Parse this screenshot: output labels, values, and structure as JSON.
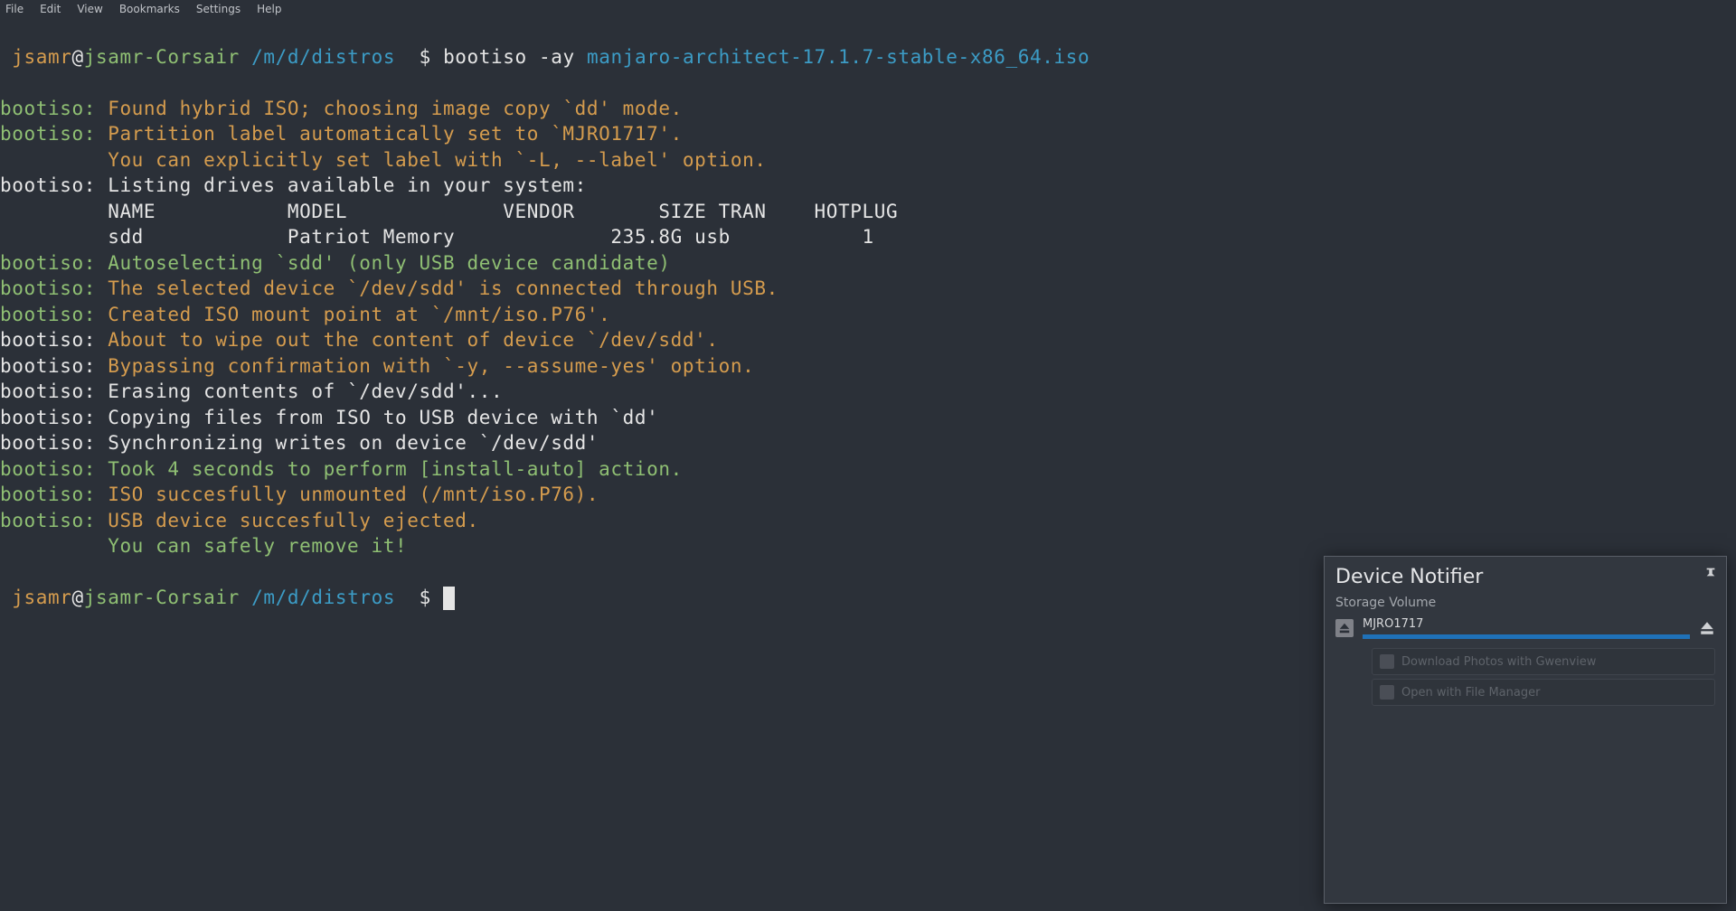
{
  "menubar": [
    "File",
    "Edit",
    "View",
    "Bookmarks",
    "Settings",
    "Help"
  ],
  "prompt": {
    "user": "jsamr",
    "at": "@",
    "host": "jsamr-Corsair",
    "path": "/m/d/distros",
    "symbol": "$"
  },
  "command": {
    "bin": "bootiso",
    "flags": "-ay",
    "iso": "manjaro-architect-17.1.7-stable-x86_64.iso"
  },
  "lines": [
    {
      "tag": "bootiso:",
      "cls": "g",
      "rest": " Found hybrid ISO; choosing image copy `dd' mode.",
      "rcls": "y"
    },
    {
      "tag": "bootiso:",
      "cls": "g",
      "rest": " Partition label automatically set to `MJRO1717'.",
      "rcls": "y"
    },
    {
      "tag": "        ",
      "cls": "w",
      "rest": " You can explicitly set label with `-L, --label' option.",
      "rcls": "y"
    },
    {
      "tag": "bootiso:",
      "cls": "w",
      "rest": " Listing drives available in your system:",
      "rcls": "w"
    },
    {
      "tag": "        ",
      "cls": "w",
      "rest": " NAME           MODEL             VENDOR       SIZE TRAN    HOTPLUG",
      "rcls": "w"
    },
    {
      "tag": "        ",
      "cls": "w",
      "rest": " sdd            Patriot Memory             235.8G usb           1",
      "rcls": "w"
    },
    {
      "tag": "bootiso:",
      "cls": "g",
      "rest": " Autoselecting `sdd' (only USB device candidate)",
      "rcls": "g"
    },
    {
      "tag": "bootiso:",
      "cls": "g",
      "rest": " The selected device `/dev/sdd' is connected through USB.",
      "rcls": "y"
    },
    {
      "tag": "bootiso:",
      "cls": "g",
      "rest": " Created ISO mount point at `/mnt/iso.P76'.",
      "rcls": "y"
    },
    {
      "tag": "bootiso:",
      "cls": "w",
      "rest": " About to wipe out the content of device `/dev/sdd'.",
      "rcls": "y"
    },
    {
      "tag": "bootiso:",
      "cls": "w",
      "rest": " Bypassing confirmation with `-y, --assume-yes' option.",
      "rcls": "y"
    },
    {
      "tag": "bootiso:",
      "cls": "w",
      "rest": " Erasing contents of `/dev/sdd'...",
      "rcls": "w"
    },
    {
      "tag": "bootiso:",
      "cls": "w",
      "rest": " Copying files from ISO to USB device with `dd'",
      "rcls": "w"
    },
    {
      "tag": "bootiso:",
      "cls": "w",
      "rest": " Synchronizing writes on device `/dev/sdd'",
      "rcls": "w"
    },
    {
      "tag": "bootiso:",
      "cls": "g",
      "rest": " Took 4 seconds to perform [install-auto] action.",
      "rcls": "g"
    },
    {
      "tag": "bootiso:",
      "cls": "g",
      "rest": " ISO succesfully unmounted (/mnt/iso.P76).",
      "rcls": "y"
    },
    {
      "tag": "bootiso:",
      "cls": "g",
      "rest": " USB device succesfully ejected.",
      "rcls": "y"
    },
    {
      "tag": "        ",
      "cls": "w",
      "rest": " You can safely remove it!",
      "rcls": "g"
    }
  ],
  "notifier": {
    "title": "Device Notifier",
    "subhead": "Storage Volume",
    "volume_label": "MJRO1717",
    "actions": [
      "Download Photos with Gwenview",
      "Open with File Manager"
    ]
  }
}
